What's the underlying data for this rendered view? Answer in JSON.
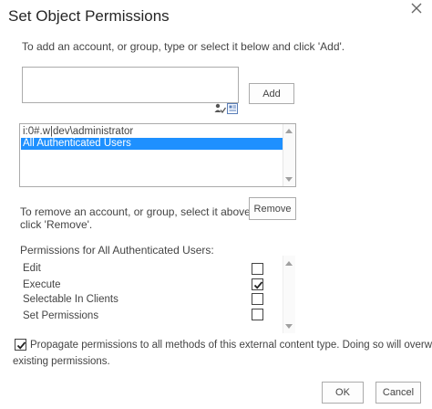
{
  "dialog": {
    "title": "Set Object Permissions",
    "close_glyph": "×"
  },
  "add_section": {
    "instructions": "To add an account, or group, type or select it below and click 'Add'.",
    "input_value": "",
    "add_label": "Add"
  },
  "accounts": {
    "items": [
      {
        "label": "i:0#.w|dev\\administrator",
        "selected": false
      },
      {
        "label": "All Authenticated Users",
        "selected": true
      }
    ]
  },
  "remove_section": {
    "instructions_line1": "To remove an account, or group, select it above and",
    "instructions_line2": "click 'Remove'.",
    "remove_label": "Remove"
  },
  "permissions": {
    "heading": "Permissions for All Authenticated Users:",
    "items": [
      {
        "label": "Edit",
        "checked": false
      },
      {
        "label": "Execute",
        "checked": true
      },
      {
        "label": "Selectable In Clients",
        "checked": false
      },
      {
        "label": "Set Permissions",
        "checked": false
      }
    ]
  },
  "propagate": {
    "checked": true,
    "line1": "Propagate permissions to all methods of this external content type. Doing so will overwrite",
    "line2": "existing permissions."
  },
  "footer": {
    "ok_label": "OK",
    "cancel_label": "Cancel"
  },
  "icons": {
    "people_picker": "check-names-icon",
    "browse": "address-book-icon"
  },
  "colors": {
    "selection": "#1e90ff",
    "text": "#444444",
    "title": "#262626",
    "border": "#ababab"
  }
}
